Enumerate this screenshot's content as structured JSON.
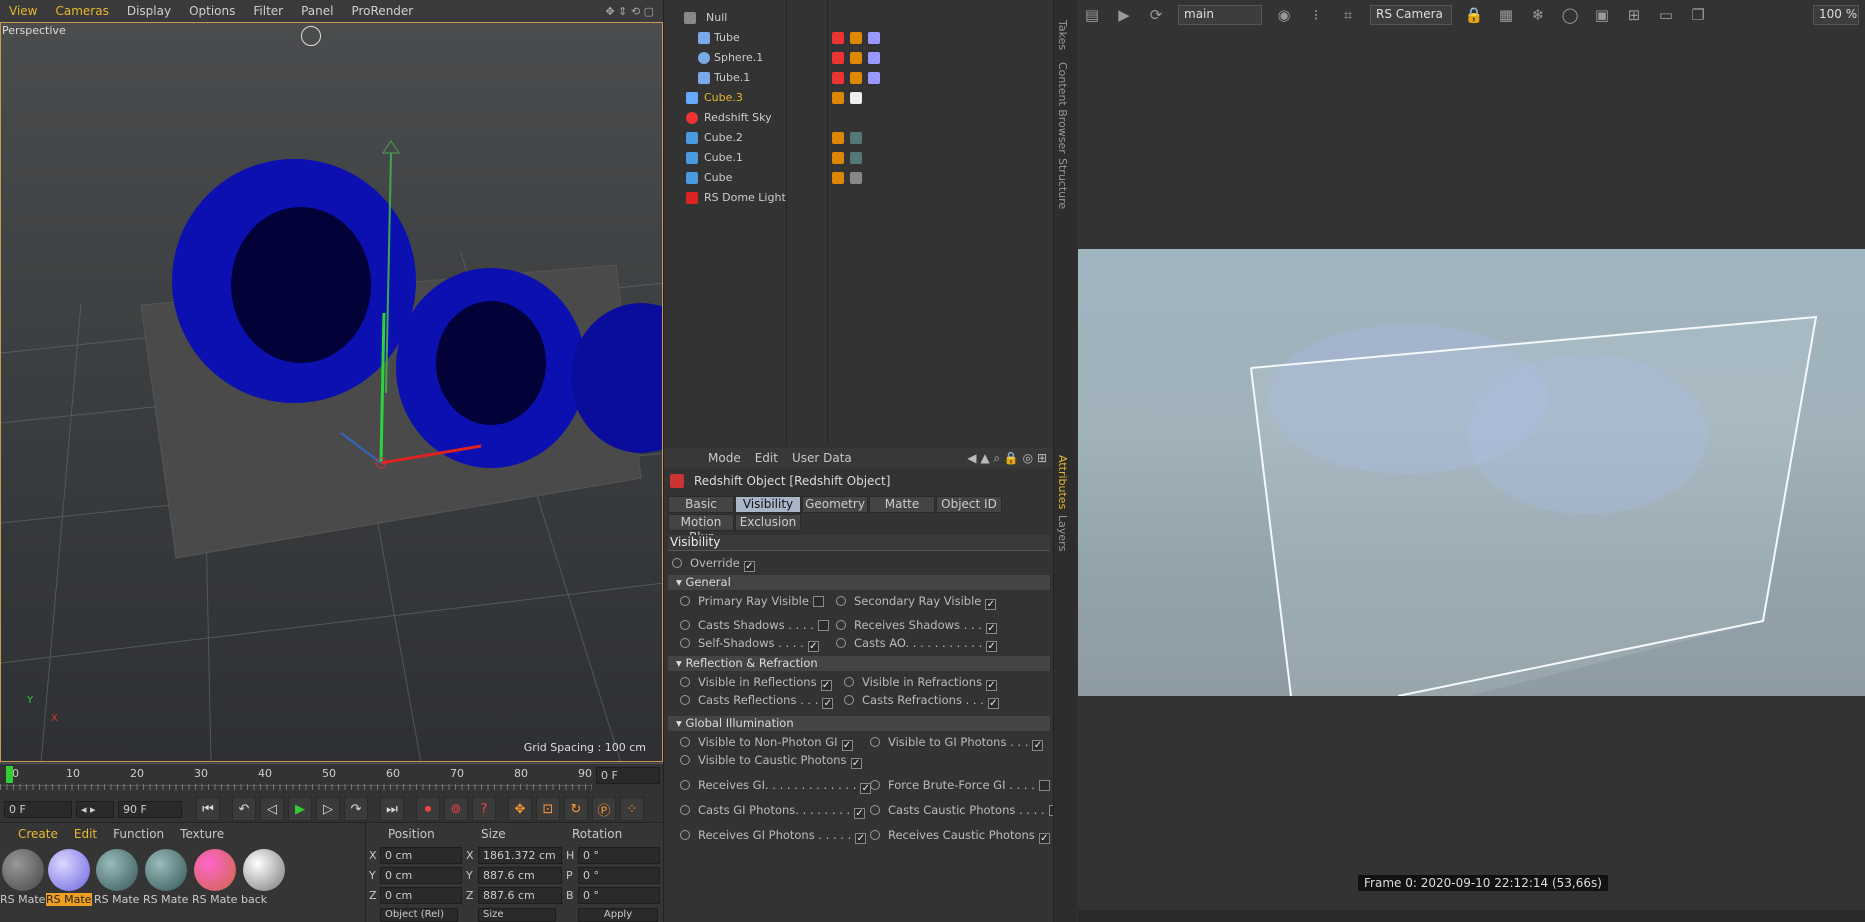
{
  "viewport": {
    "menu": [
      "View",
      "Cameras",
      "Display",
      "Options",
      "Filter",
      "Panel",
      "ProRender"
    ],
    "label": "Perspective",
    "grid_spacing": "Grid Spacing : 100 cm",
    "axis_y": "Y",
    "axis_x": "X"
  },
  "timeline": {
    "ticks": [
      "0",
      "10",
      "20",
      "30",
      "40",
      "50",
      "60",
      "70",
      "80",
      "90"
    ],
    "end_frame": "0 F",
    "current": "0 F",
    "max": "90 F"
  },
  "materials": {
    "menu": [
      "Create",
      "Edit",
      "Function",
      "Texture"
    ],
    "items": [
      "RS Mate",
      "RS Mate",
      "RS Mate",
      "RS Mate",
      "RS Mate",
      "back"
    ]
  },
  "coords": {
    "headers": [
      "Position",
      "Size",
      "Rotation"
    ],
    "rows": [
      {
        "axis": "X",
        "pos": "0 cm",
        "saxis": "X",
        "size": "1861.372 cm",
        "raxis": "H",
        "rot": "0 °"
      },
      {
        "axis": "Y",
        "pos": "0 cm",
        "saxis": "Y",
        "size": "887.6 cm",
        "raxis": "P",
        "rot": "0 °"
      },
      {
        "axis": "Z",
        "pos": "0 cm",
        "saxis": "Z",
        "size": "887.6 cm",
        "raxis": "B",
        "rot": "0 °"
      }
    ],
    "mode": "Object (Rel)",
    "size_mode": "Size",
    "apply": "Apply"
  },
  "objects": [
    "Null",
    "Tube",
    "Sphere.1",
    "Tube.1",
    "Cube.3",
    "Redshift Sky",
    "Cube.2",
    "Cube.1",
    "Cube",
    "RS Dome Light"
  ],
  "attributes": {
    "menu": [
      "Mode",
      "Edit",
      "User Data"
    ],
    "title": "Redshift Object [Redshift Object]",
    "tabs": [
      "Basic",
      "Visibility",
      "Geometry",
      "Matte",
      "Object ID",
      "Motion Blur",
      "Exclusion"
    ],
    "section": "Visibility",
    "override": "Override",
    "general": "General",
    "primary": "Primary Ray Visible",
    "secondary": "Secondary Ray Visible",
    "casts_shadows": "Casts Shadows . . . .",
    "receives_shadows": "Receives Shadows . . .",
    "self_shadows": "Self-Shadows . . . .",
    "casts_ao": "Casts AO. . . . . . . . . . .",
    "refl_refr": "Reflection & Refraction",
    "vis_refl": "Visible in Reflections",
    "vis_refr": "Visible in Refractions",
    "casts_refl": "Casts Reflections . . .",
    "casts_refr": "Casts Refractions . . .",
    "gi": "Global Illumination",
    "vis_nonphoton": "Visible to Non-Photon GI",
    "vis_gi_photons": "Visible to GI Photons . . .",
    "vis_caustic": "Visible to Caustic Photons",
    "receives_gi": "Receives GI. . . . . . . . . . . . .",
    "force_brute": "Force Brute-Force GI . . . .",
    "casts_gi_photons": "Casts GI Photons. . . . . . . .",
    "casts_caustic": "Casts Caustic Photons . . . .",
    "receives_gi_photons": "Receives GI Photons . . . . .",
    "receives_caustic": "Receives Caustic Photons"
  },
  "sidetabs": [
    "Takes",
    "Content Browser",
    "Structure",
    "Attributes",
    "Layers"
  ],
  "renderview": {
    "display": "main",
    "camera": "RS Camera",
    "zoom": "100 %",
    "frame": "Frame  0:  2020-09-10  22:12:14  (53,66s)"
  }
}
